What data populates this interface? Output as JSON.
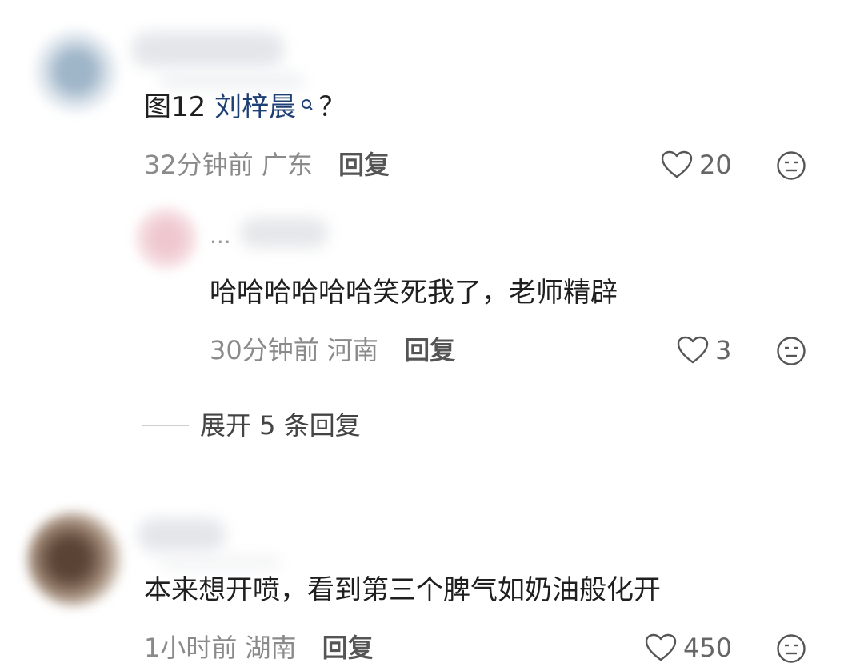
{
  "comments": [
    {
      "text_prefix": "图12 ",
      "mention": "刘梓晨",
      "text_suffix": "？",
      "time": "32分钟前",
      "location": "广东",
      "reply_label": "回复",
      "likes": "20"
    },
    {
      "name_visible": "...",
      "text": "哈哈哈哈哈哈笑死我了，老师精辟",
      "time": "30分钟前",
      "location": "河南",
      "reply_label": "回复",
      "likes": "3"
    },
    {
      "text": "本来想开喷，看到第三个脾气如奶油般化开",
      "time": "1小时前",
      "location": "湖南",
      "reply_label": "回复",
      "likes": "450"
    }
  ],
  "expand_replies_label": "展开 5 条回复",
  "colors": {
    "mention": "#1d3f73",
    "meta": "#8a8a8a",
    "text": "#1f1f1f"
  }
}
